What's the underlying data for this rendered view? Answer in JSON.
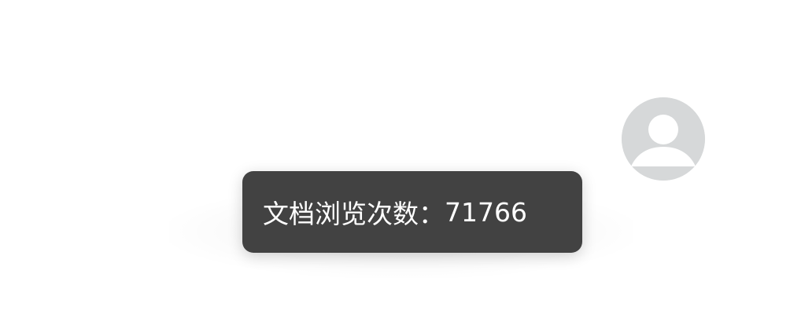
{
  "tooltip": {
    "label": "文档浏览次数：",
    "value": "71766"
  },
  "avatar": {
    "icon": "user-avatar-icon",
    "background": "#d6d8d9",
    "foreground": "#ffffff"
  },
  "colors": {
    "tooltip_background": "#424242",
    "tooltip_text": "#ffffff"
  }
}
